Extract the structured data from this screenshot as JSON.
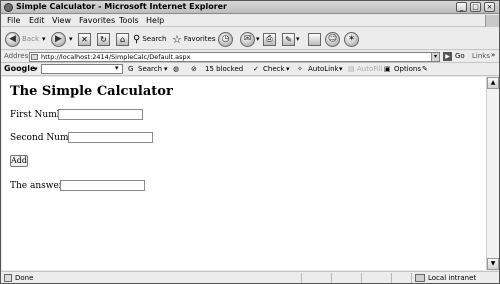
{
  "window": {
    "title": "Simple Calculator - Microsoft Internet Explorer",
    "controls": {
      "minimize": "_",
      "maximize": "□",
      "close": "×"
    }
  },
  "menu": [
    "File",
    "Edit",
    "View",
    "Favorites",
    "Tools",
    "Help"
  ],
  "toolbar": {
    "back_label": "Back",
    "search_label": "Search",
    "favorites_label": "Favorites"
  },
  "address": {
    "label": "Address",
    "url": "http://localhost:2414/SimpleCalc/Default.aspx",
    "go_label": "Go",
    "links_label": "Links"
  },
  "google_bar": {
    "logo": "Google",
    "search_label": "Search",
    "blocked_label": "15 blocked",
    "check_label": "Check",
    "autolink_label": "AutoLink",
    "autofill_label": "AutoFill",
    "options_label": "Options"
  },
  "page": {
    "title": "The Simple Calculator",
    "first_label": "First Number:",
    "first_value": "",
    "second_label": "Second Number:",
    "second_value": "",
    "add_button": "Add",
    "answer_label": "The answer is:",
    "answer_value": ""
  },
  "status": {
    "text": "Done",
    "zone": "Local intranet"
  }
}
